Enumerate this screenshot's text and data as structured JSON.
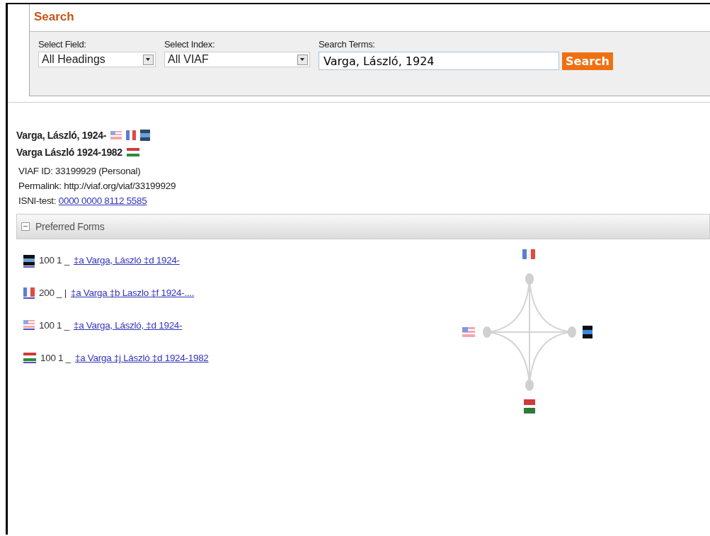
{
  "search": {
    "title": "Search",
    "field": {
      "label": "Select Field:",
      "value": "All Headings"
    },
    "index": {
      "label": "Select Index:",
      "value": "All VIAF"
    },
    "terms": {
      "label": "Search Terms:",
      "value": "Varga, László, 1924"
    },
    "button": "Search"
  },
  "headings": [
    {
      "text": "Varga, László, 1924-",
      "flags": [
        {
          "kind": "us"
        },
        {
          "kind": "fr"
        },
        {
          "kind": "dnb"
        }
      ]
    },
    {
      "text": "Varga László 1924-1982",
      "flags": [
        {
          "kind": "hu"
        }
      ]
    }
  ],
  "details": [
    {
      "text": "VIAF ID: 33199929 (Personal)"
    },
    {
      "text": "Permalink: http://viaf.org/viaf/33199929"
    },
    {
      "text": "ISNI-test: ",
      "link": "0000 0000 8112 5585"
    }
  ],
  "preferred_forms": {
    "title": "Preferred Forms",
    "expanded": true,
    "rows": [
      {
        "kind": "dnb",
        "tag": "100 1 _",
        "link": "‡a  Varga, László ‡d  1924-"
      },
      {
        "kind": "fr",
        "tag": "200 _ |",
        "link": "‡a  Varga ‡b  Laszlo ‡f  1924-...."
      },
      {
        "kind": "us",
        "tag": "100 1 _",
        "link": "‡a  Varga, László, ‡d  1924-"
      },
      {
        "kind": "hu",
        "tag": "100 1 _",
        "link": "‡a  Varga ‡j  László ‡d  1924-1982"
      }
    ],
    "graph": [
      {
        "kind": "fr"
      },
      {
        "kind": "dnb"
      },
      {
        "kind": "hu"
      },
      {
        "kind": "us"
      }
    ]
  }
}
